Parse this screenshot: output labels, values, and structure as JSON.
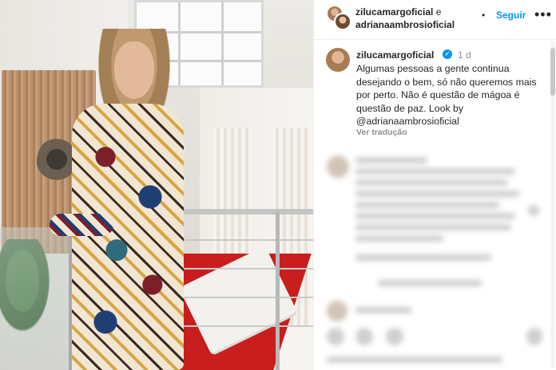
{
  "colors": {
    "link_blue": "#0095f6",
    "text": "#262626",
    "muted": "#8e8e8e",
    "verified": "#0095f6"
  },
  "post": {
    "image_alt": "",
    "header": {
      "user1": "zilucamargoficial",
      "conjunction": "e",
      "user2": "adrianaambrosioficial",
      "separator": "•",
      "follow_label": "Seguir",
      "more_icon": "more-icon"
    },
    "caption": {
      "username": "zilucamargoficial",
      "verified_icon": "verified-icon",
      "time": "1 d",
      "text": "Algumas pessoas a gente continua desejando o bem, só não queremos mais por perto. Não é questão de mágoa é questão de paz. Look by @adrianaambrosioficial",
      "translate_label": "Ver tradução"
    }
  }
}
